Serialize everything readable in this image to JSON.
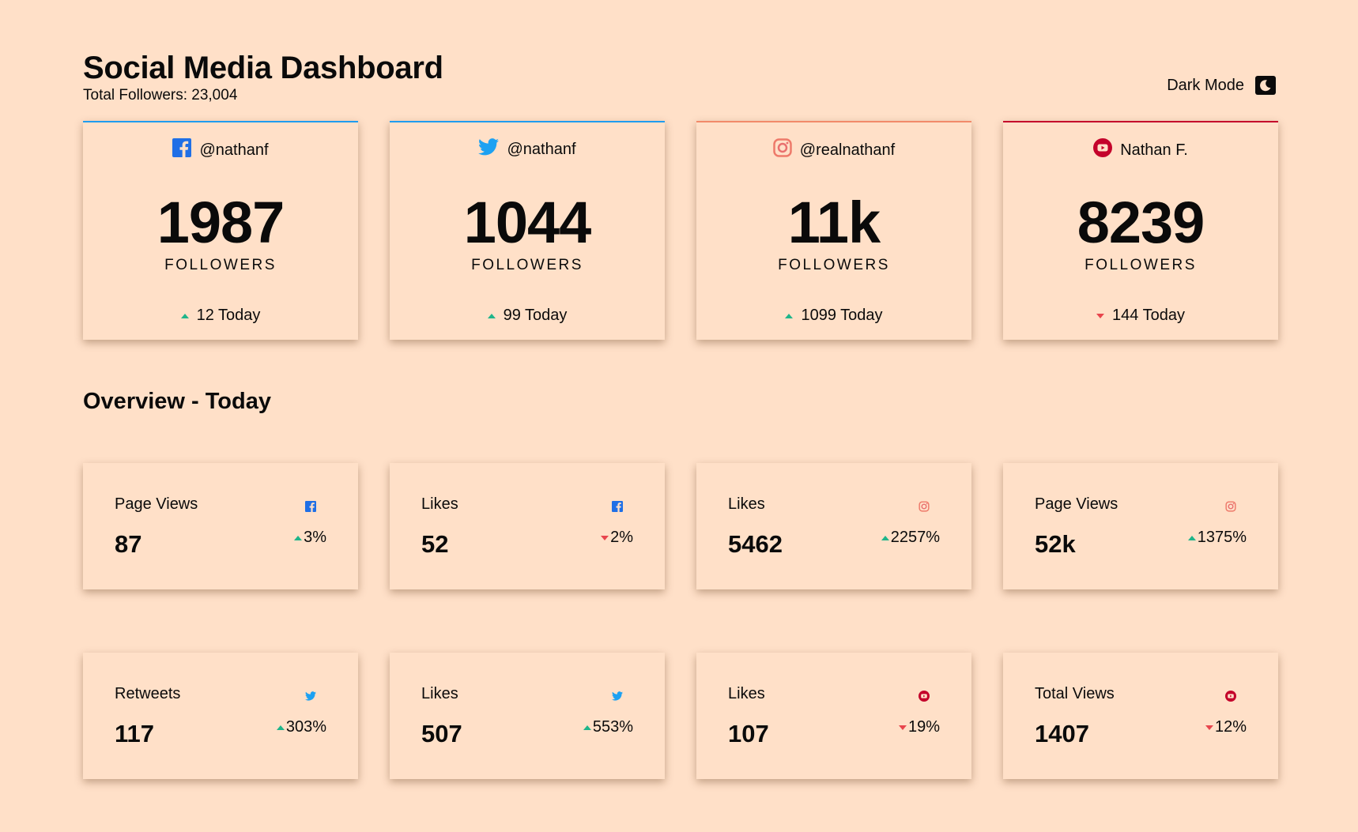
{
  "header": {
    "title": "Social Media Dashboard",
    "total_followers": "Total Followers: 23,004",
    "dark_mode_label": "Dark Mode"
  },
  "followers": [
    {
      "platform": "facebook",
      "icon": "facebook-icon",
      "handle": "@nathanf",
      "count": "1987",
      "label": "FOLLOWERS",
      "today": "12 Today",
      "trend": "up",
      "accent": "#1f9cef"
    },
    {
      "platform": "twitter",
      "icon": "twitter-icon",
      "handle": "@nathanf",
      "count": "1044",
      "label": "FOLLOWERS",
      "today": "99 Today",
      "trend": "up",
      "accent": "#1f9cef"
    },
    {
      "platform": "instagram",
      "icon": "instagram-icon",
      "handle": "@realnathanf",
      "count": "11k",
      "label": "FOLLOWERS",
      "today": "1099 Today",
      "trend": "up",
      "accent": "#f28a6a"
    },
    {
      "platform": "youtube",
      "icon": "youtube-icon",
      "handle": "Nathan F.",
      "count": "8239",
      "label": "FOLLOWERS",
      "today": "144 Today",
      "trend": "down",
      "accent": "#c4032b"
    }
  ],
  "overview": {
    "title": "Overview - Today",
    "cards": [
      {
        "label": "Page Views",
        "platform": "facebook",
        "value": "87",
        "change": "3%",
        "trend": "up"
      },
      {
        "label": "Likes",
        "platform": "facebook",
        "value": "52",
        "change": "2%",
        "trend": "down"
      },
      {
        "label": "Likes",
        "platform": "instagram",
        "value": "5462",
        "change": "2257%",
        "trend": "up"
      },
      {
        "label": "Page Views",
        "platform": "instagram",
        "value": "52k",
        "change": "1375%",
        "trend": "up"
      },
      {
        "label": "Retweets",
        "platform": "twitter",
        "value": "117",
        "change": "303%",
        "trend": "up"
      },
      {
        "label": "Likes",
        "platform": "twitter",
        "value": "507",
        "change": "553%",
        "trend": "up"
      },
      {
        "label": "Likes",
        "platform": "youtube",
        "value": "107",
        "change": "19%",
        "trend": "down"
      },
      {
        "label": "Total Views",
        "platform": "youtube",
        "value": "1407",
        "change": "12%",
        "trend": "down"
      }
    ]
  },
  "colors": {
    "background": "#ffe0c8",
    "facebook": "#1f9cef",
    "twitter": "#1da1f2",
    "instagram": "#f28a6a",
    "youtube": "#c4032b",
    "up": "#1fb58a",
    "down": "#e8454d"
  }
}
